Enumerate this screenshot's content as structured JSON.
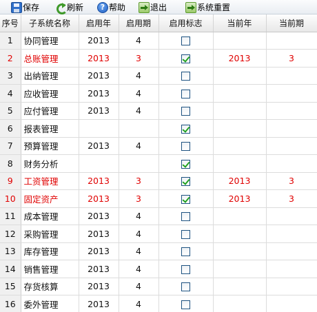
{
  "toolbar": {
    "buttons": [
      {
        "label": "保存",
        "icon": "save-icon"
      },
      {
        "label": "刷新",
        "icon": "refresh-icon"
      },
      {
        "label": "帮助",
        "icon": "help-icon"
      },
      {
        "label": "退出",
        "icon": "exit-icon"
      },
      {
        "label": "系统重置",
        "icon": "reset-icon"
      }
    ],
    "help_glyph": "?"
  },
  "table": {
    "columns": [
      "序号",
      "子系统名称",
      "启用年",
      "启用期",
      "启用标志",
      "当前年",
      "当前期"
    ],
    "rows": [
      {
        "seq": "1",
        "name": "协同管理",
        "year": "2013",
        "period": "4",
        "enabled": false,
        "cur_year": "",
        "cur_period": "",
        "active": false
      },
      {
        "seq": "2",
        "name": "总账管理",
        "year": "2013",
        "period": "3",
        "enabled": true,
        "cur_year": "2013",
        "cur_period": "3",
        "active": true
      },
      {
        "seq": "3",
        "name": "出纳管理",
        "year": "2013",
        "period": "4",
        "enabled": false,
        "cur_year": "",
        "cur_period": "",
        "active": false
      },
      {
        "seq": "4",
        "name": "应收管理",
        "year": "2013",
        "period": "4",
        "enabled": false,
        "cur_year": "",
        "cur_period": "",
        "active": false
      },
      {
        "seq": "5",
        "name": "应付管理",
        "year": "2013",
        "period": "4",
        "enabled": false,
        "cur_year": "",
        "cur_period": "",
        "active": false
      },
      {
        "seq": "6",
        "name": "报表管理",
        "year": "",
        "period": "",
        "enabled": true,
        "cur_year": "",
        "cur_period": "",
        "active": false
      },
      {
        "seq": "7",
        "name": "预算管理",
        "year": "2013",
        "period": "4",
        "enabled": false,
        "cur_year": "",
        "cur_period": "",
        "active": false
      },
      {
        "seq": "8",
        "name": "财务分析",
        "year": "",
        "period": "",
        "enabled": true,
        "cur_year": "",
        "cur_period": "",
        "active": false
      },
      {
        "seq": "9",
        "name": "工资管理",
        "year": "2013",
        "period": "3",
        "enabled": true,
        "cur_year": "2013",
        "cur_period": "3",
        "active": true
      },
      {
        "seq": "10",
        "name": "固定资产",
        "year": "2013",
        "period": "3",
        "enabled": true,
        "cur_year": "2013",
        "cur_period": "3",
        "active": true
      },
      {
        "seq": "11",
        "name": "成本管理",
        "year": "2013",
        "period": "4",
        "enabled": false,
        "cur_year": "",
        "cur_period": "",
        "active": false
      },
      {
        "seq": "12",
        "name": "采购管理",
        "year": "2013",
        "period": "4",
        "enabled": false,
        "cur_year": "",
        "cur_period": "",
        "active": false
      },
      {
        "seq": "13",
        "name": "库存管理",
        "year": "2013",
        "period": "4",
        "enabled": false,
        "cur_year": "",
        "cur_period": "",
        "active": false
      },
      {
        "seq": "14",
        "name": "销售管理",
        "year": "2013",
        "period": "4",
        "enabled": false,
        "cur_year": "",
        "cur_period": "",
        "active": false
      },
      {
        "seq": "15",
        "name": "存货核算",
        "year": "2013",
        "period": "4",
        "enabled": false,
        "cur_year": "",
        "cur_period": "",
        "active": false
      },
      {
        "seq": "16",
        "name": "委外管理",
        "year": "2013",
        "period": "4",
        "enabled": false,
        "cur_year": "",
        "cur_period": "",
        "active": false
      }
    ]
  },
  "colors": {
    "active_row_text": "#e00000",
    "check_mark": "#21a121"
  }
}
